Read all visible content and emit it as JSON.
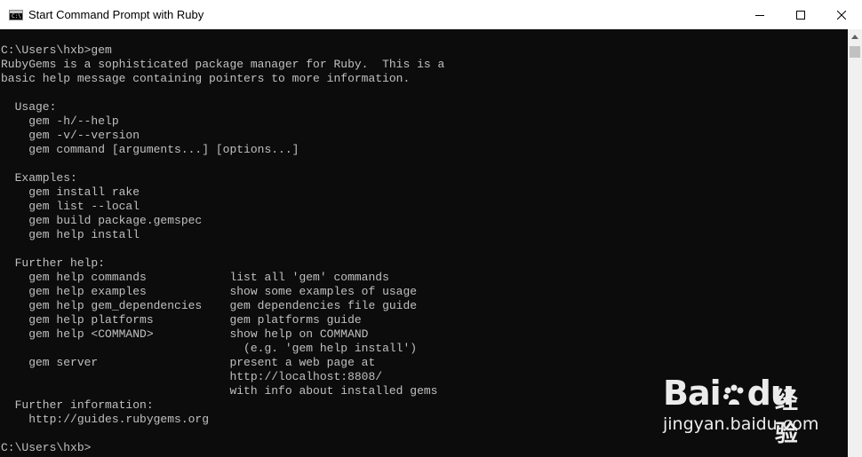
{
  "window": {
    "title": "Start Command Prompt with Ruby",
    "icon": "cmd-icon",
    "controls": [
      "minimize",
      "maximize",
      "close"
    ]
  },
  "console": {
    "lines": [
      "C:\\Users\\hxb>gem",
      "RubyGems is a sophisticated package manager for Ruby.  This is a",
      "basic help message containing pointers to more information.",
      "",
      "  Usage:",
      "    gem -h/--help",
      "    gem -v/--version",
      "    gem command [arguments...] [options...]",
      "",
      "  Examples:",
      "    gem install rake",
      "    gem list --local",
      "    gem build package.gemspec",
      "    gem help install",
      "",
      "  Further help:",
      "    gem help commands            list all 'gem' commands",
      "    gem help examples            show some examples of usage",
      "    gem help gem_dependencies    gem dependencies file guide",
      "    gem help platforms           gem platforms guide",
      "    gem help <COMMAND>           show help on COMMAND",
      "                                   (e.g. 'gem help install')",
      "    gem server                   present a web page at",
      "                                 http://localhost:8808/",
      "                                 with info about installed gems",
      "  Further information:",
      "    http://guides.rubygems.org",
      "",
      "C:\\Users\\hxb>"
    ]
  },
  "watermark": {
    "brand": "Bai",
    "brand2": "du",
    "cn": "经验",
    "sub": "jingyan.baidu.com"
  },
  "colors": {
    "console_bg": "#0c0c0c",
    "console_fg": "#c0c0c0",
    "titlebar_bg": "#ffffff"
  }
}
